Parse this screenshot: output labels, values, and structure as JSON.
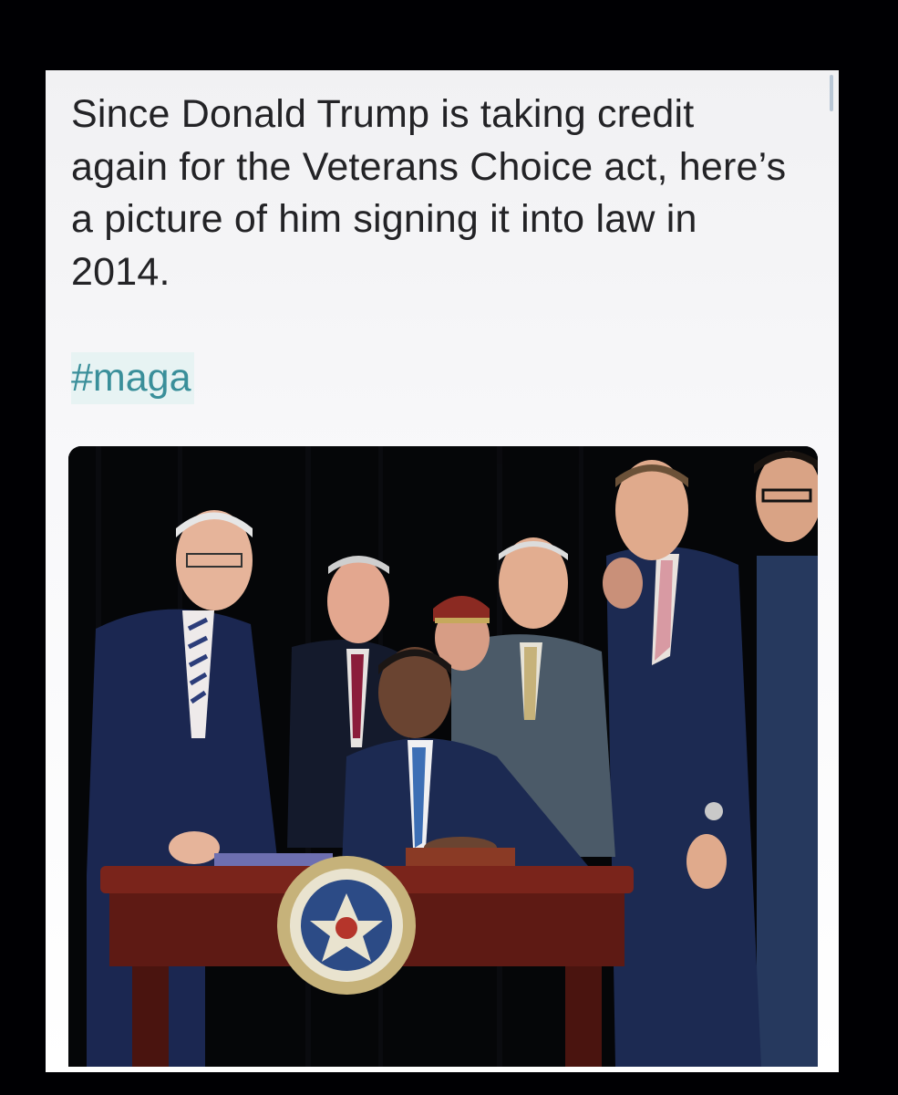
{
  "post": {
    "text": "Since Donald Trump is taking credit again for the Veterans Choice act, here’s a picture of him signing it into law in 2014.",
    "hashtag": "#maga"
  },
  "photo": {
    "subject": "bill-signing-photo",
    "colors": {
      "backdrop": "#050608",
      "suit_navy": "#1c2a52",
      "suit_gray": "#4b5a68",
      "desk_wood": "#6b1f18",
      "seal_blue": "#2c4b86",
      "seal_gold": "#c6b27a"
    }
  }
}
